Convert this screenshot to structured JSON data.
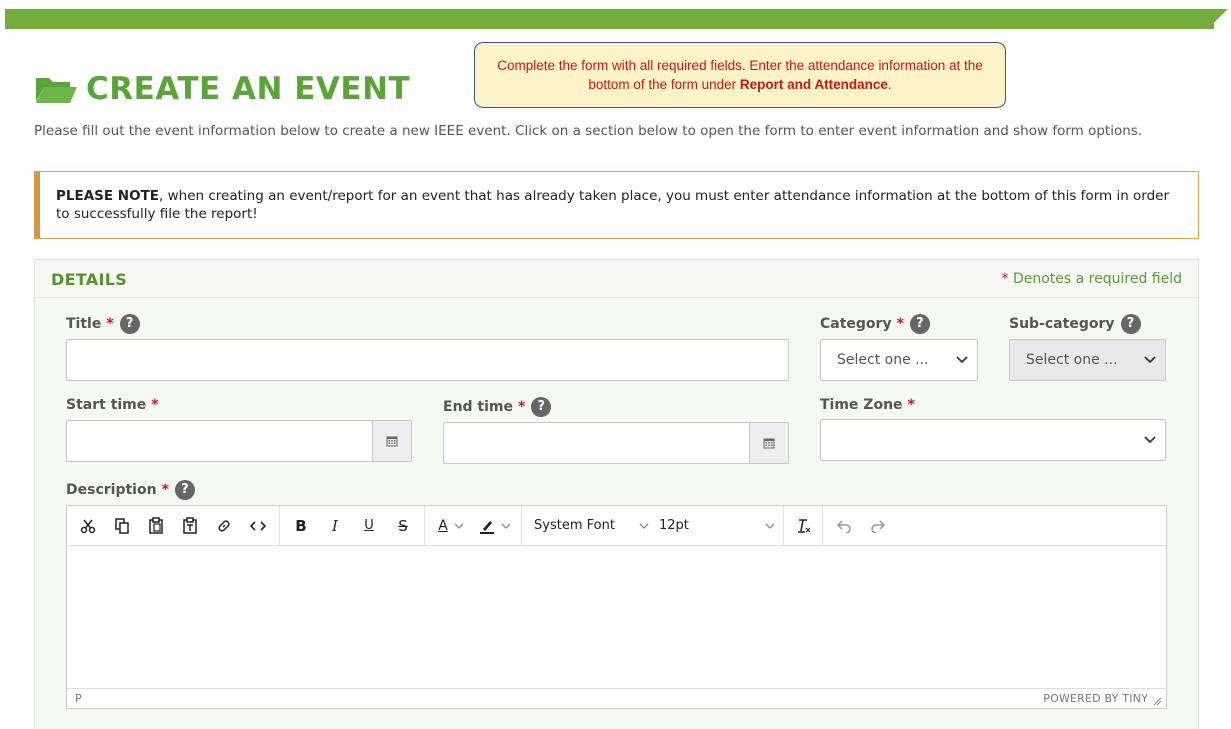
{
  "header": {
    "title": "CREATE AN EVENT",
    "folder_icon": "folder-open-icon",
    "brand_color": "#74ad3e",
    "title_color": "#5aa53a"
  },
  "callout": {
    "text_before": "Complete the form with all required fields. Enter the attendance information at the bottom of the form under ",
    "emphasis": "Report and Attendance",
    "text_after": "."
  },
  "intro": "Please fill out the event information below to create a new IEEE event. Click on a section below to open the form to enter event information and show form options.",
  "notice": {
    "lead": "PLEASE NOTE",
    "text": ", when creating an event/report for an event that has already taken place, you must enter attendance information at the bottom of this form in order to successfully file the report!"
  },
  "details": {
    "heading": "DETAILS",
    "required_star": "*",
    "required_note": "Denotes a required field",
    "fields": {
      "title": {
        "label": "Title",
        "star": "*",
        "value": ""
      },
      "category": {
        "label": "Category",
        "star": "*",
        "selected": "Select one ..."
      },
      "subcategory": {
        "label": "Sub-category",
        "selected": "Select one ..."
      },
      "start_time": {
        "label": "Start time",
        "star": "*",
        "value": ""
      },
      "end_time": {
        "label": "End time",
        "star": "*",
        "value": ""
      },
      "time_zone": {
        "label": "Time Zone",
        "star": "*",
        "selected": ""
      },
      "description": {
        "label": "Description",
        "star": "*"
      }
    },
    "help_glyph": "?"
  },
  "editor": {
    "font_family": "System Font",
    "font_size": "12pt",
    "tools": {
      "cut": "scissors-icon",
      "copy": "copy-icon",
      "paste": "paste-icon",
      "paste_text": "paste-text-icon",
      "link": "link-icon",
      "code": "code-icon",
      "bold": "B",
      "italic": "I",
      "underline": "U",
      "strike": "S",
      "font_color": "A",
      "clear_format": "T",
      "undo": "undo-icon",
      "redo": "redo-icon"
    },
    "path": "P",
    "powered": "POWERED BY TINY"
  }
}
